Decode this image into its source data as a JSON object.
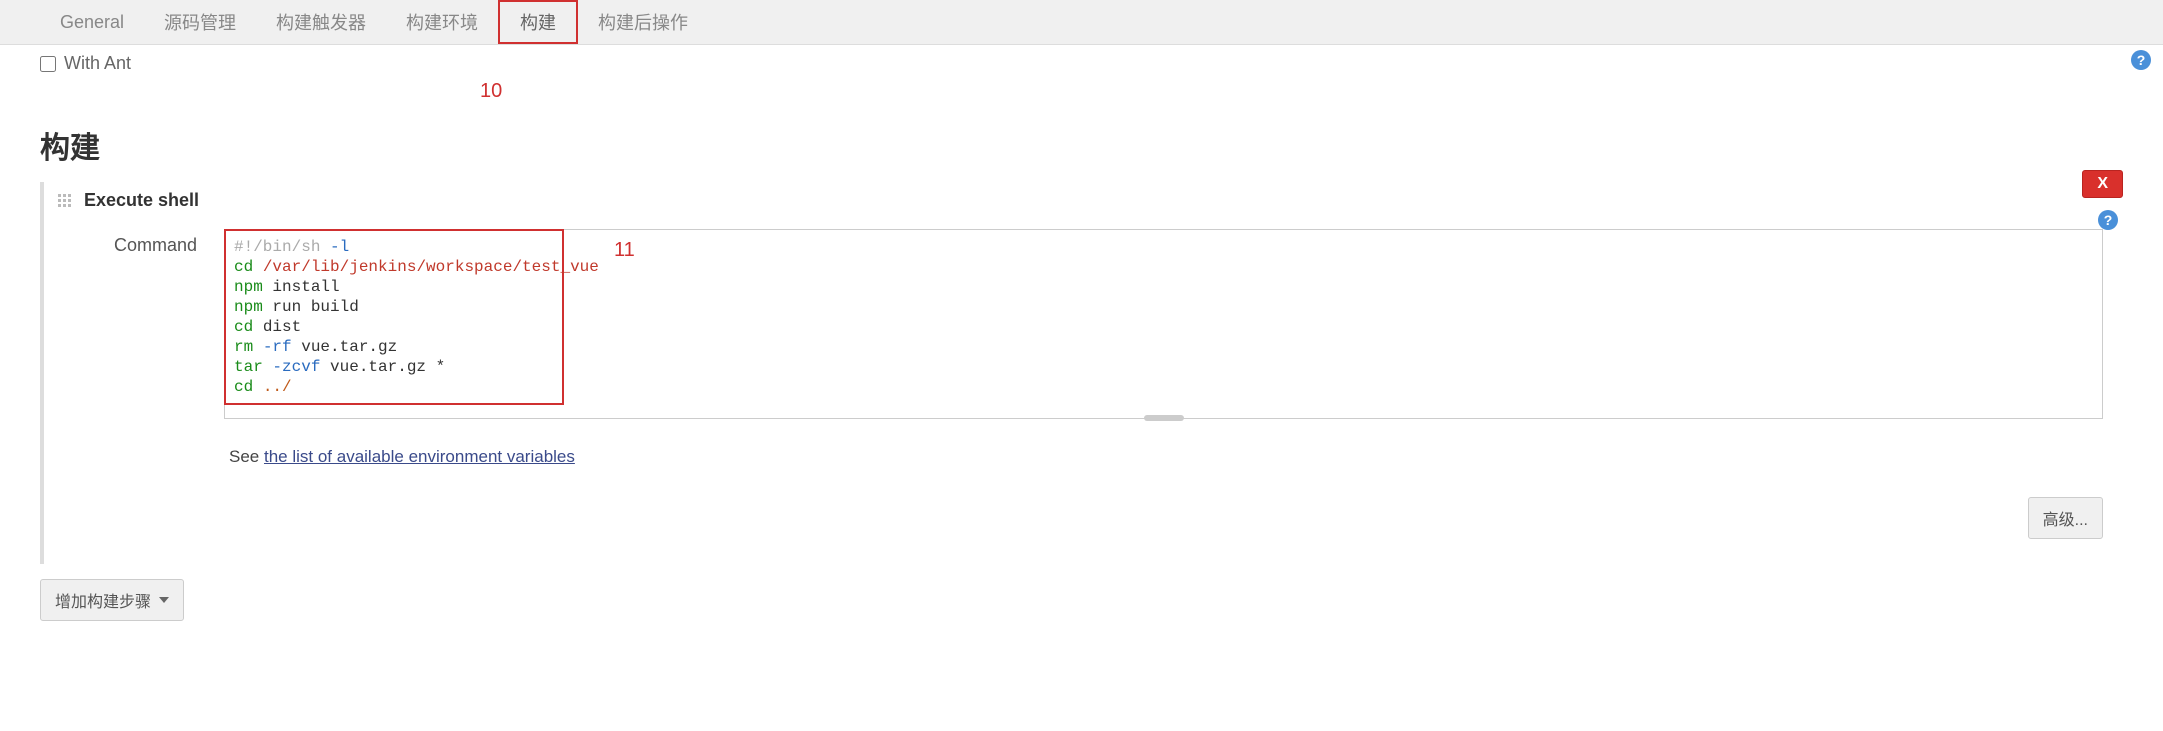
{
  "tabs": {
    "general": "General",
    "scm": "源码管理",
    "triggers": "构建触发器",
    "env": "构建环境",
    "build": "构建",
    "post": "构建后操作"
  },
  "withAnt": {
    "label": "With Ant"
  },
  "annotations": {
    "a10": "10",
    "a11": "11"
  },
  "section": {
    "build": "构建"
  },
  "step": {
    "title": "Execute shell",
    "delete": "X",
    "cmdLabel": "Command",
    "help": "?",
    "code": {
      "l1a": "#!/bin/sh ",
      "l1b": "-l",
      "l2a": "cd ",
      "l2b": "/var/lib/jenkins/workspace/test_vue",
      "l3a": "npm ",
      "l3b": "install",
      "l4a": "npm ",
      "l4b": "run build",
      "l5a": "cd ",
      "l5b": "dist",
      "l6a": "rm ",
      "l6b": "-rf ",
      "l6c": "vue.tar.gz",
      "l7a": "tar ",
      "l7b": "-zcvf ",
      "l7c": "vue.tar.gz *",
      "l8a": "cd ",
      "l8b": "../"
    },
    "seeText": "See ",
    "seeLink": "the list of available environment variables",
    "advanced": "高级..."
  },
  "addStep": "增加构建步骤"
}
